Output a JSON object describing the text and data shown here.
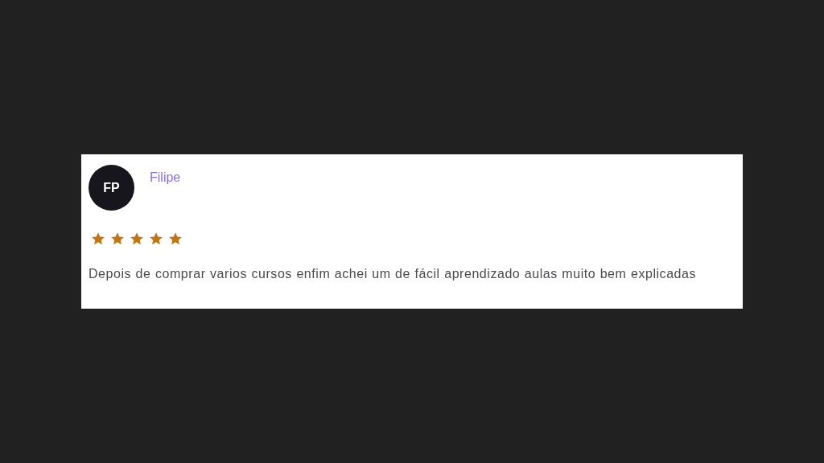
{
  "review": {
    "initials": "FP",
    "author": "Filipe",
    "stars": 5,
    "text": "Depois de comprar varios cursos enfim achei um de fácil aprendizado aulas muito bem explicadas"
  }
}
